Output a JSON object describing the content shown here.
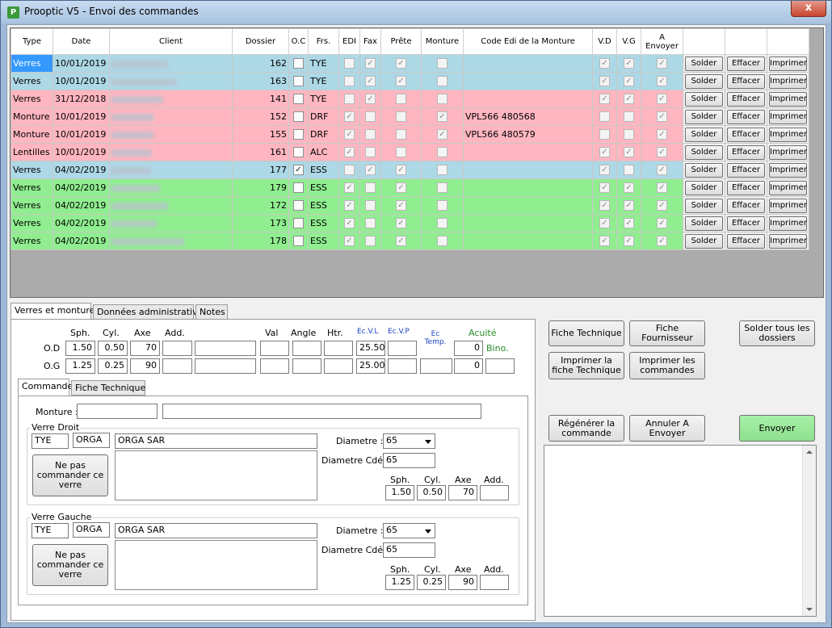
{
  "window": {
    "title": "Prooptic V5 - Envoi des commandes",
    "close_label": "x"
  },
  "grid": {
    "columns": [
      "Type",
      "Date",
      "Client",
      "Dossier",
      "O.C",
      "Frs.",
      "EDI",
      "Fax",
      "Prête",
      "Monture",
      "Code Edi de la Monture",
      "V.D",
      "V.G",
      "A Envoyer",
      "",
      "",
      ""
    ],
    "button_labels": {
      "solder": "Solder",
      "effacer": "Effacer",
      "imprimer": "Imprimer"
    },
    "rows": [
      {
        "color": "blue",
        "type": "Verres",
        "date": "10/01/2019",
        "dossier": "162",
        "oc": false,
        "frs": "TYE",
        "edi": false,
        "fax": true,
        "prete": true,
        "monture": false,
        "code": "",
        "vd": true,
        "vg": true,
        "envoyer": true,
        "selected": true
      },
      {
        "color": "blue",
        "type": "Verres",
        "date": "10/01/2019",
        "dossier": "163",
        "oc": false,
        "frs": "TYE",
        "edi": false,
        "fax": true,
        "prete": true,
        "monture": false,
        "code": "",
        "vd": true,
        "vg": true,
        "envoyer": true
      },
      {
        "color": "pink",
        "type": "Verres",
        "date": "31/12/2018",
        "dossier": "141",
        "oc": false,
        "frs": "TYE",
        "edi": false,
        "fax": true,
        "prete": false,
        "monture": false,
        "code": "",
        "vd": true,
        "vg": true,
        "envoyer": true
      },
      {
        "color": "pink",
        "type": "Monture",
        "date": "10/01/2019",
        "dossier": "152",
        "oc": false,
        "frs": "DRF",
        "edi": true,
        "fax": false,
        "prete": false,
        "monture": true,
        "code": "VPL566 480568",
        "vd": false,
        "vg": false,
        "envoyer": true
      },
      {
        "color": "pink",
        "type": "Monture",
        "date": "10/01/2019",
        "dossier": "155",
        "oc": false,
        "frs": "DRF",
        "edi": true,
        "fax": false,
        "prete": false,
        "monture": true,
        "code": "VPL566 480579",
        "vd": false,
        "vg": false,
        "envoyer": true
      },
      {
        "color": "pink",
        "type": "Lentilles",
        "date": "10/01/2019",
        "dossier": "161",
        "oc": false,
        "frs": "ALC",
        "edi": true,
        "fax": false,
        "prete": false,
        "monture": false,
        "code": "",
        "vd": true,
        "vg": true,
        "envoyer": true
      },
      {
        "color": "blue",
        "type": "Verres",
        "date": "04/02/2019",
        "dossier": "177",
        "oc": true,
        "frs": "ESS",
        "edi": false,
        "fax": true,
        "prete": true,
        "monture": false,
        "code": "",
        "vd": true,
        "vg": false,
        "envoyer": true
      },
      {
        "color": "green",
        "type": "Verres",
        "date": "04/02/2019",
        "dossier": "179",
        "oc": false,
        "frs": "ESS",
        "edi": true,
        "fax": false,
        "prete": true,
        "monture": false,
        "code": "",
        "vd": true,
        "vg": true,
        "envoyer": true
      },
      {
        "color": "green",
        "type": "Verres",
        "date": "04/02/2019",
        "dossier": "172",
        "oc": false,
        "frs": "ESS",
        "edi": true,
        "fax": false,
        "prete": true,
        "monture": false,
        "code": "",
        "vd": true,
        "vg": true,
        "envoyer": true
      },
      {
        "color": "green",
        "type": "Verres",
        "date": "04/02/2019",
        "dossier": "173",
        "oc": false,
        "frs": "ESS",
        "edi": true,
        "fax": false,
        "prete": true,
        "monture": false,
        "code": "",
        "vd": true,
        "vg": true,
        "envoyer": true
      },
      {
        "color": "green",
        "type": "Verres",
        "date": "04/02/2019",
        "dossier": "178",
        "oc": false,
        "frs": "ESS",
        "edi": true,
        "fax": false,
        "prete": true,
        "monture": false,
        "code": "",
        "vd": true,
        "vg": true,
        "envoyer": true
      }
    ]
  },
  "tabs_top": [
    "Verres et montures",
    "Données administratives",
    "Notes"
  ],
  "measures": {
    "headers": {
      "sph": "Sph.",
      "cyl": "Cyl.",
      "axe": "Axe",
      "add": "Add.",
      "val": "Val",
      "angle": "Angle",
      "htr": "Htr.",
      "ecvl": "Ec.V.L",
      "ecvp": "Ec.V.P",
      "ectemp": "Ec Temp.",
      "acuite": "Acuité",
      "bino": "Bino."
    },
    "od": {
      "label": "O.D",
      "sph": "1.50",
      "cyl": "0.50",
      "axe": "70",
      "ecvl": "25.50",
      "acuite": "0"
    },
    "og": {
      "label": "O.G",
      "sph": "1.25",
      "cyl": "0.25",
      "axe": "90",
      "ecvl": "25.00",
      "acuite": "0"
    }
  },
  "tabs_inner": [
    "Commande",
    "Fiche Technique"
  ],
  "commande": {
    "monture_label": "Monture :",
    "verre_droit": {
      "title": "Verre Droit",
      "frs": "TYE",
      "code": "ORGA",
      "name": "ORGA SAR",
      "nepas": "Ne pas commander ce verre",
      "diametre_label": "Diametre :",
      "diametre": "65",
      "diametre_cde_label": "Diametre Cdé :",
      "diametre_cde": "65",
      "sph": "1.50",
      "cyl": "0.50",
      "axe": "70"
    },
    "verre_gauche": {
      "title": "Verre Gauche",
      "frs": "TYE",
      "code": "ORGA",
      "name": "ORGA SAR",
      "nepas": "Ne pas commander ce verre",
      "diametre_label": "Diametre :",
      "diametre": "65",
      "diametre_cde_label": "Diametre Cdé :",
      "diametre_cde": "65",
      "sph": "1.25",
      "cyl": "0.25",
      "axe": "90"
    },
    "labels": {
      "sph": "Sph.",
      "cyl": "Cyl.",
      "axe": "Axe",
      "add": "Add."
    }
  },
  "actions": {
    "fiche_technique": "Fiche Technique",
    "fiche_fournisseur": "Fiche Fournisseur",
    "solder_tous": "Solder tous les dossiers",
    "imprimer_fiche": "Imprimer la fiche Technique",
    "imprimer_commandes": "Imprimer les commandes",
    "regenerer": "Régénérer la commande",
    "annuler": "Annuler A Envoyer",
    "envoyer": "Envoyer"
  },
  "colors": {
    "blue_row": "#add8e6",
    "pink_row": "#ffb6c1",
    "green_row": "#90ee90",
    "selected": "#3399ff",
    "envoyer_btn": "#98e898"
  }
}
